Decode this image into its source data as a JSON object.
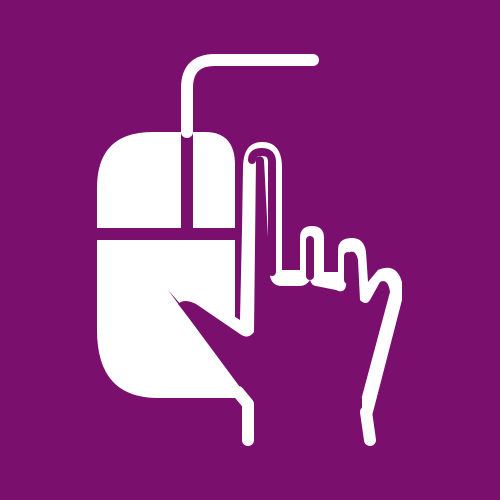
{
  "icon": {
    "name": "mouse-click-hand-icon",
    "background_color": "#7B0F6E",
    "foreground_color": "#FFFFFF"
  }
}
